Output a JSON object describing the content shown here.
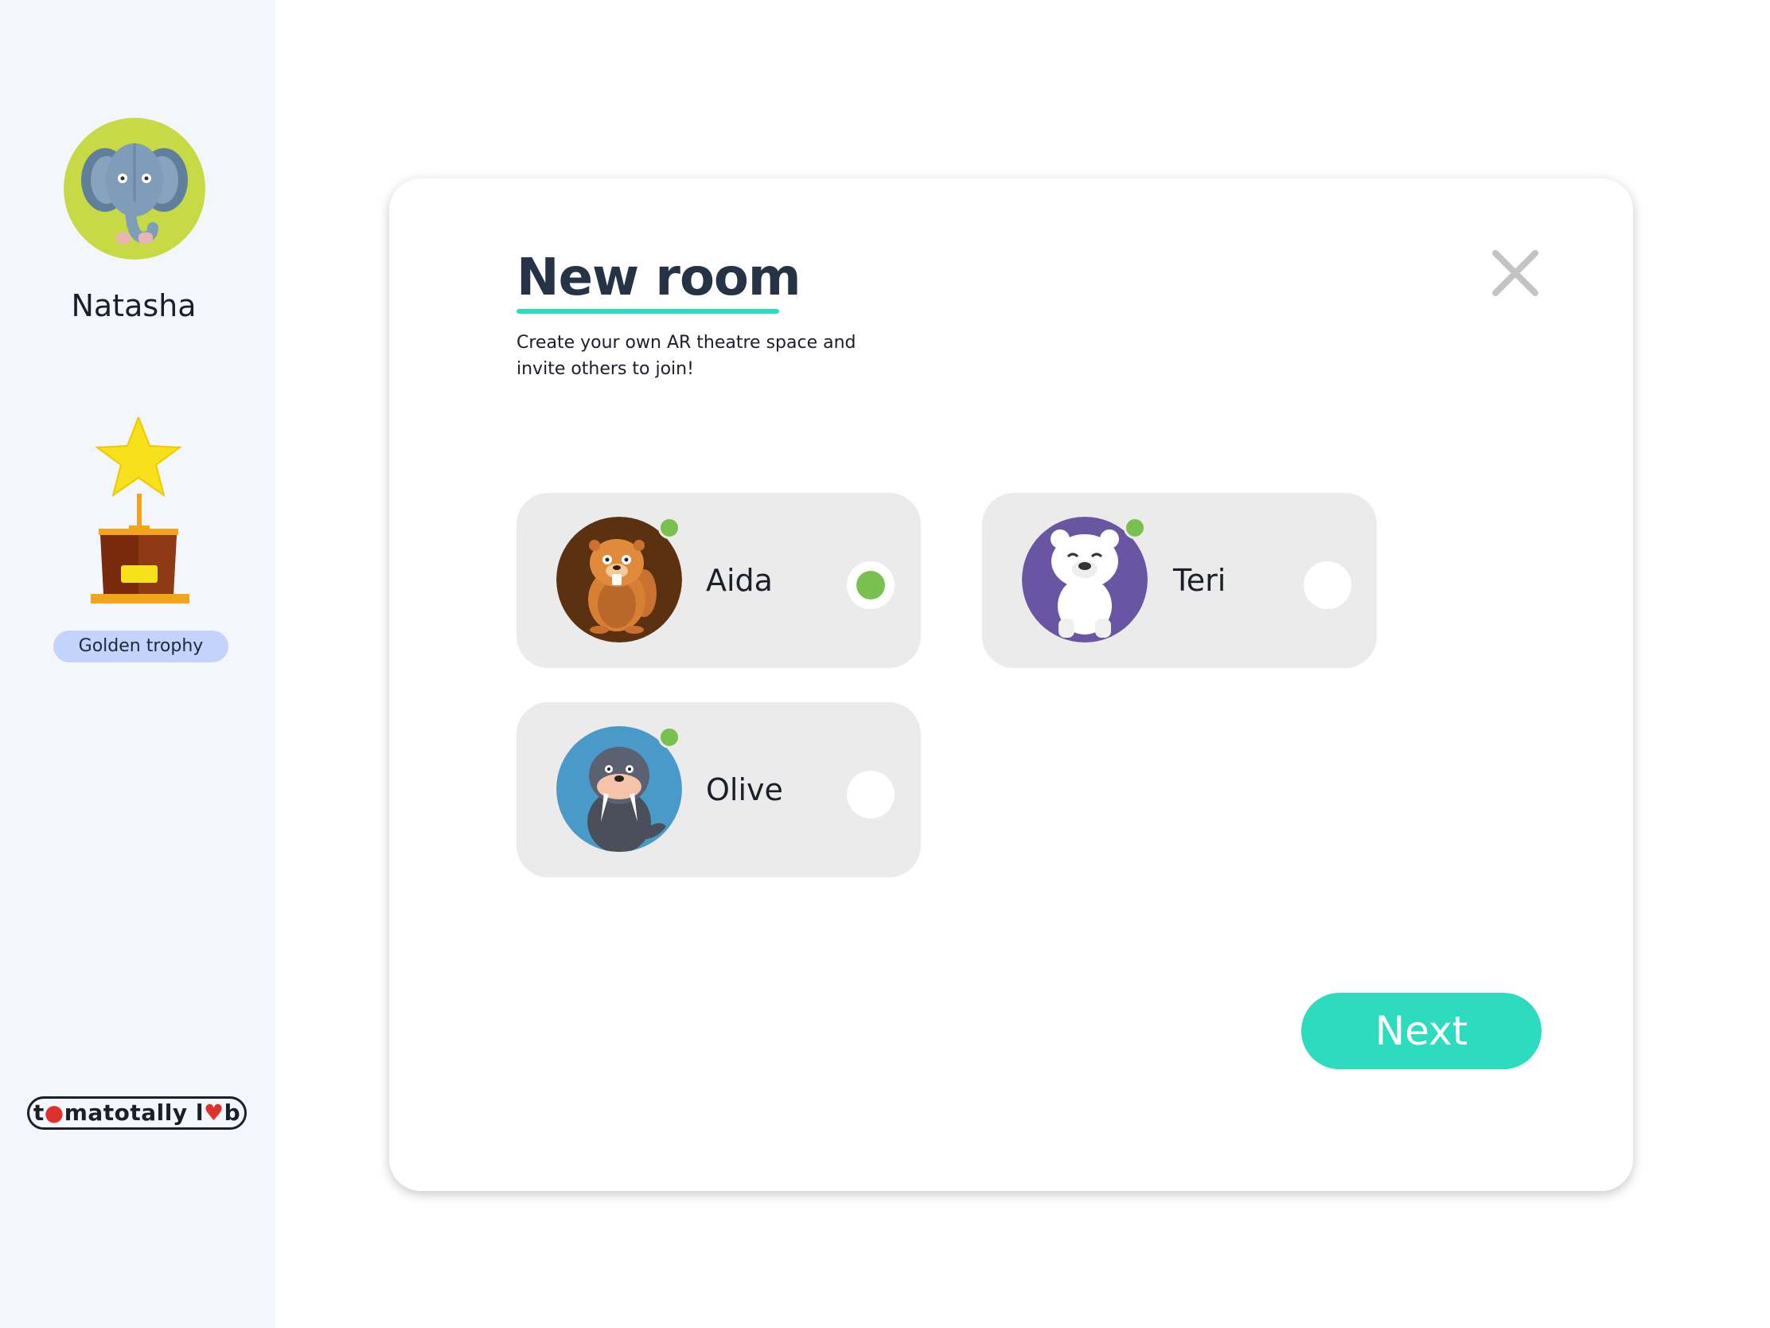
{
  "sidebar": {
    "user_name": "Natasha",
    "avatar": "elephant-icon",
    "achievement": {
      "icon": "trophy-icon",
      "label": "Golden trophy"
    },
    "brand_prefix": "t",
    "brand_middle": "matotally l",
    "brand_suffix": "b"
  },
  "modal": {
    "title": "New room",
    "subtitle": "Create your own AR theatre space and invite others to join!",
    "close_icon": "close-icon",
    "participants": [
      {
        "name": "Aida",
        "avatar": "beaver-icon",
        "online": true,
        "selected": true
      },
      {
        "name": "Teri",
        "avatar": "polar-bear-icon",
        "online": true,
        "selected": false
      },
      {
        "name": "Olive",
        "avatar": "walrus-icon",
        "online": true,
        "selected": false
      }
    ],
    "next_label": "Next"
  },
  "colors": {
    "accent": "#2ddbbf",
    "online": "#7ac050",
    "title": "#263347",
    "sidebar_bg": "#f4f6fd",
    "badge_bg": "#c3d3fb"
  }
}
